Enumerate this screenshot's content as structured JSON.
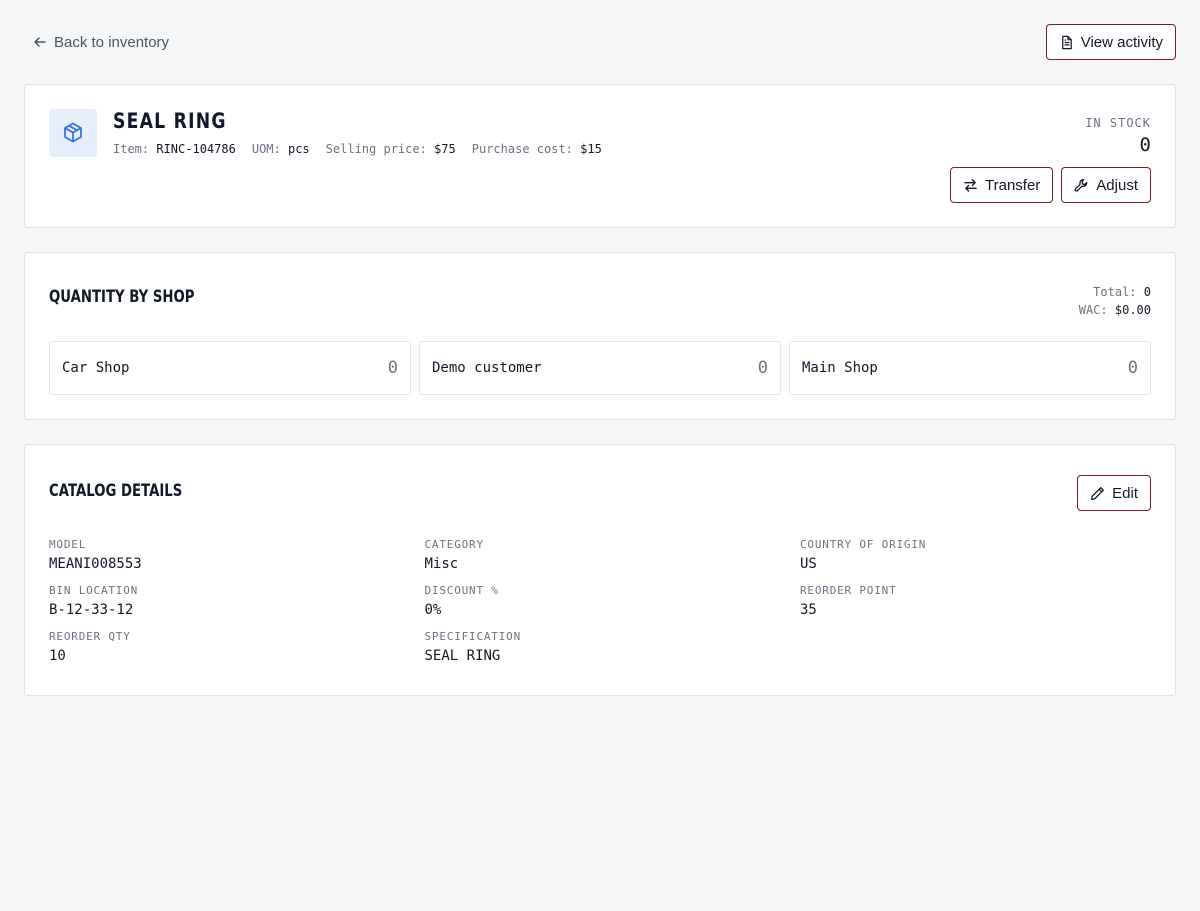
{
  "nav": {
    "back_label": "Back to inventory",
    "view_activity_label": "View activity"
  },
  "item": {
    "title": "SEAL RING",
    "meta": [
      {
        "label": "Item:",
        "value": "RINC-104786"
      },
      {
        "label": "UOM:",
        "value": "pcs"
      },
      {
        "label": "Selling price:",
        "value": "$75"
      },
      {
        "label": "Purchase cost:",
        "value": "$15"
      }
    ],
    "stock_label": "IN STOCK",
    "stock_value": "0",
    "transfer_label": "Transfer",
    "adjust_label": "Adjust",
    "icon": "package-icon"
  },
  "quantity": {
    "title": "QUANTITY BY SHOP",
    "total_label": "Total:",
    "total_value": "0",
    "wac_label": "WAC:",
    "wac_value": "$0.00",
    "shops": [
      {
        "name": "Car Shop",
        "qty": "0"
      },
      {
        "name": "Demo customer",
        "qty": "0"
      },
      {
        "name": "Main Shop",
        "qty": "0"
      }
    ]
  },
  "catalog": {
    "title": "CATALOG DETAILS",
    "edit_label": "Edit",
    "fields": [
      {
        "label": "MODEL",
        "value": "MEANI008553"
      },
      {
        "label": "CATEGORY",
        "value": "Misc"
      },
      {
        "label": "COUNTRY OF ORIGIN",
        "value": "US"
      },
      {
        "label": "BIN LOCATION",
        "value": "B-12-33-12"
      },
      {
        "label": "DISCOUNT %",
        "value": "0%"
      },
      {
        "label": "REORDER POINT",
        "value": "35"
      },
      {
        "label": "REORDER QTY",
        "value": "10"
      },
      {
        "label": "SPECIFICATION",
        "value": "SEAL RING"
      }
    ]
  },
  "colors": {
    "accent_border": "#7a1f1f",
    "icon_blue": "#2f6fe0",
    "icon_bg": "#e7eefb",
    "page_bg": "#f5f6f8"
  }
}
